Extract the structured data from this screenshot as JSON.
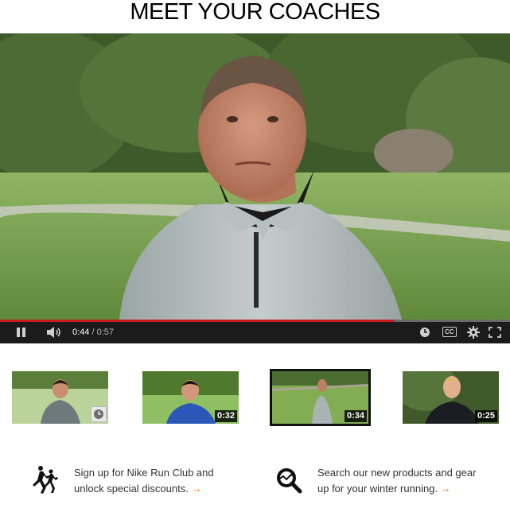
{
  "page": {
    "title": "MEET YOUR COACHES"
  },
  "player": {
    "current_time": "0:44",
    "separator": "/",
    "duration": "0:57",
    "progress": 0.772,
    "accent_color": "#cc181e",
    "icons": [
      "pause-icon",
      "volume-icon",
      "watch-later-icon",
      "captions-icon",
      "settings-icon",
      "fullscreen-icon"
    ],
    "captions_label": "CC"
  },
  "playlist": [
    {
      "duration": null,
      "badge_icon": "clock-icon",
      "active": false
    },
    {
      "duration": "0:32",
      "active": false
    },
    {
      "duration": "0:34",
      "active": true
    },
    {
      "duration": "0:25",
      "active": false
    }
  ],
  "promos": [
    {
      "icon": "runners-icon",
      "line1": "Sign up for Nike Run Club and",
      "line2": "unlock special discounts.",
      "arrow": "→"
    },
    {
      "icon": "search-icon",
      "line1": "Search our new products and gear",
      "line2": "up for your winter running.",
      "arrow": "→"
    }
  ]
}
